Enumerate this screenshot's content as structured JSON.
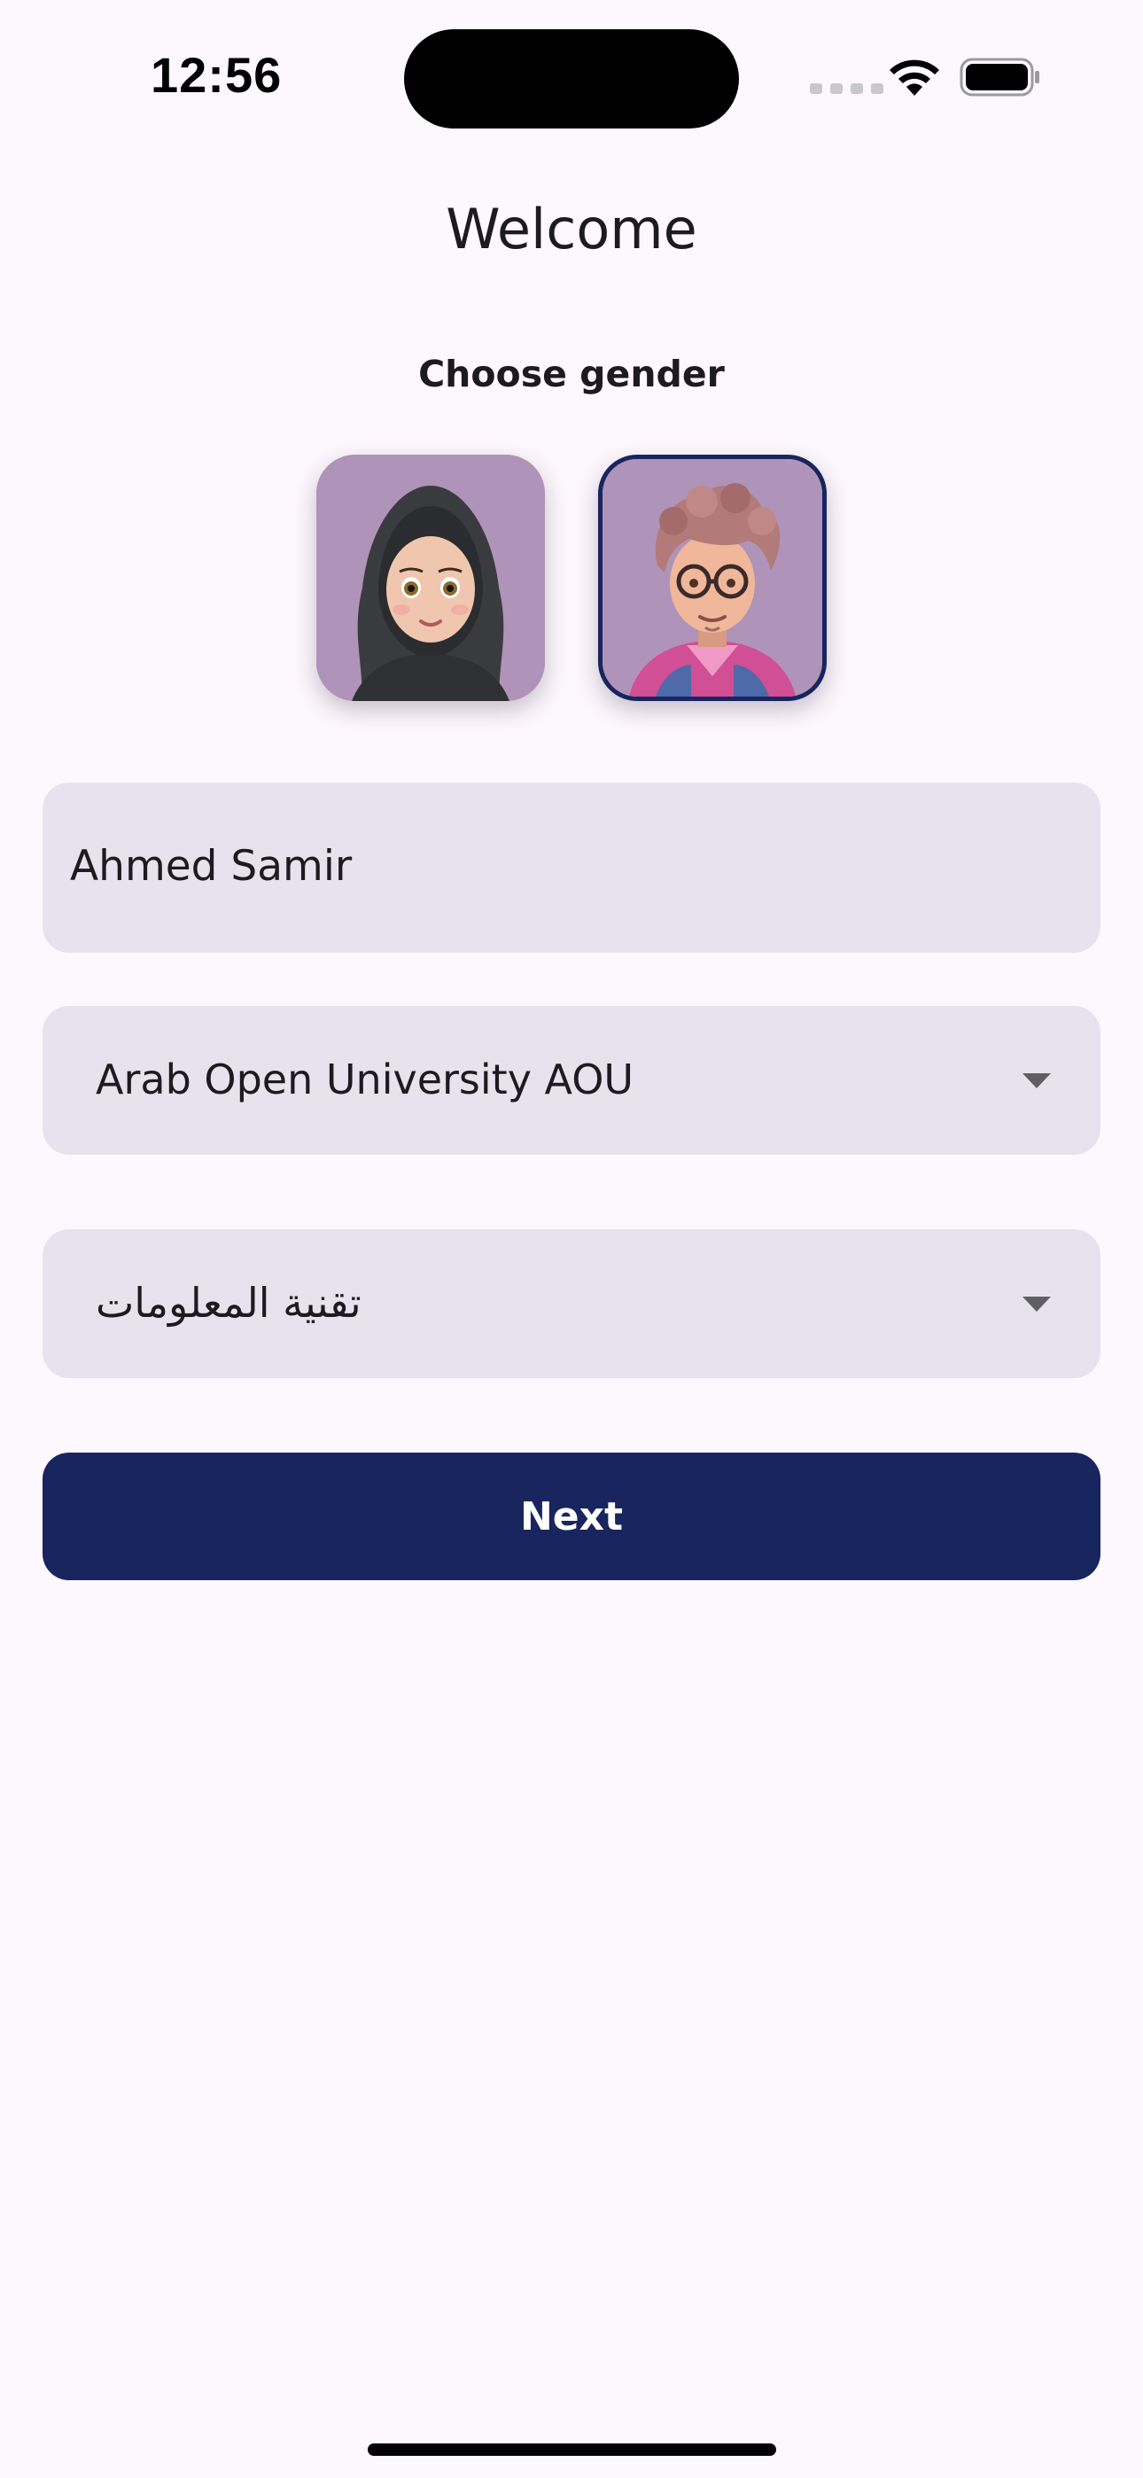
{
  "status_bar": {
    "time": "12:56"
  },
  "page": {
    "title": "Welcome",
    "subtitle": "Choose gender"
  },
  "gender": {
    "options": [
      {
        "id": "female",
        "icon": "female-avatar-icon",
        "selected": false
      },
      {
        "id": "male",
        "icon": "male-avatar-icon",
        "selected": true
      }
    ]
  },
  "form": {
    "name_value": "Ahmed Samir",
    "university_value": "Arab Open University AOU",
    "major_value": "تقنية المعلومات"
  },
  "actions": {
    "next_label": "Next"
  },
  "colors": {
    "background": "#fdf8fd",
    "field_background": "#e6e3ee",
    "primary": "#18255f",
    "avatar_background": "#b093b8"
  }
}
